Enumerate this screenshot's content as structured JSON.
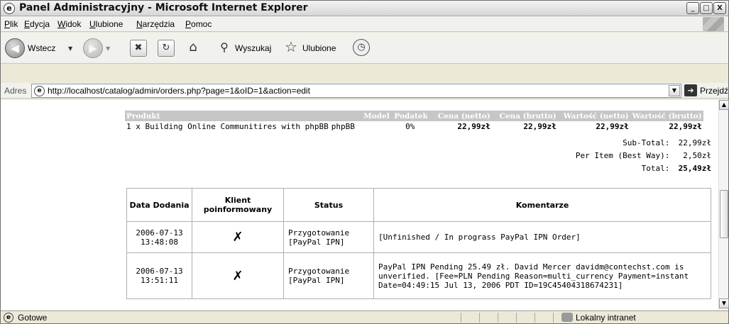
{
  "window": {
    "title": "Panel Administracyjny - Microsoft Internet Explorer",
    "controls": [
      "_",
      "□",
      "X"
    ]
  },
  "menu": [
    "Plik",
    "Edycja",
    "Widok",
    "Ulubione",
    "Narzędzia",
    "Pomoc"
  ],
  "toolbar": {
    "back_label": "Wstecz",
    "search_label": "Wyszukaj",
    "favorites_label": "Ulubione"
  },
  "address": {
    "label": "Adres",
    "url": "http://localhost/catalog/admin/orders.php?page=1&oID=1&action=edit",
    "go_label": "Przejdź"
  },
  "products": {
    "headers": [
      "Produkt",
      "Model",
      "Podatek",
      "Cena (netto)",
      "Cena (brutto)",
      "Wartość (netto)",
      "Wartość (brutto)"
    ],
    "rows": [
      {
        "product": "1 x Building Online Communitires with phpBB",
        "model": "phpBB",
        "tax": "0%",
        "price_net": "22,99zł",
        "price_gross": "22,99zł",
        "total_net": "22,99zł",
        "total_gross": "22,99zł"
      }
    ]
  },
  "totals": [
    {
      "label": "Sub-Total:",
      "value": "22,99zł"
    },
    {
      "label": "Per Item (Best Way):",
      "value": "2,50zł"
    },
    {
      "label": "Total:",
      "value": "25,49zł"
    }
  ],
  "history": {
    "headers": {
      "date": "Data Dodania",
      "notified": "Klient poinformowany",
      "status": "Status",
      "comments": "Komentarze"
    },
    "rows": [
      {
        "date": "2006-07-13 13:48:08",
        "notified": "✗",
        "status": "Przygotowanie [PayPal IPN]",
        "comment": "[Unfinished / In prograss PayPal IPN Order]"
      },
      {
        "date": "2006-07-13 13:51:11",
        "notified": "✗",
        "status": "Przygotowanie [PayPal IPN]",
        "comment": "PayPal IPN Pending 25.49 zł. David Mercer davidm@contechst.com is unverified. [Fee=PLN Pending Reason=multi_currency Payment=instant Date=04:49:15 Jul 13, 2006 PDT ID=19C45404318674231]"
      }
    ]
  },
  "status": {
    "text": "Gotowe",
    "zone": "Lokalny intranet"
  }
}
